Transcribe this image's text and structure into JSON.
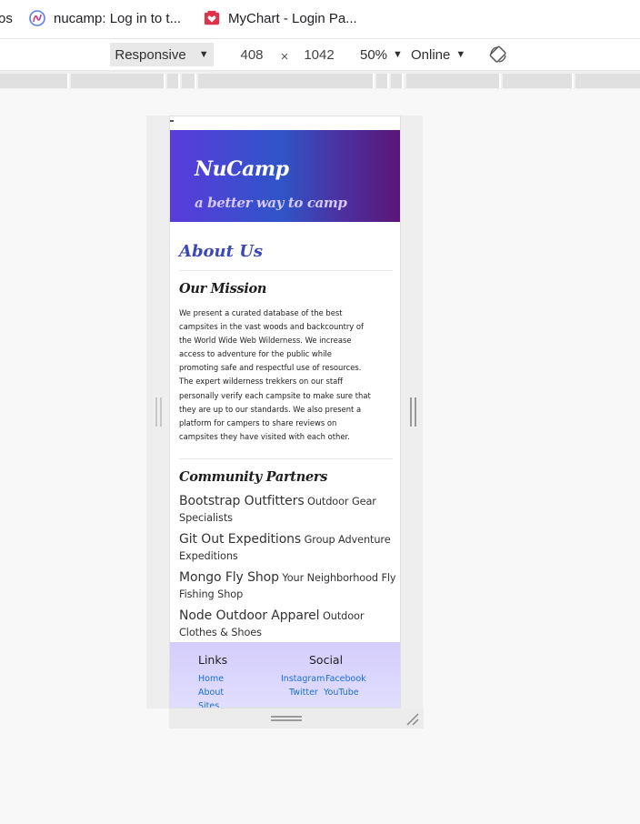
{
  "browser": {
    "bookmarks": [
      {
        "label": "os",
        "icon": "cut-off-icon"
      },
      {
        "label": "nucamp: Log in to t...",
        "icon": "nucamp-logo-icon"
      },
      {
        "label": "MyChart - Login Pa...",
        "icon": "mychart-heart-icon"
      }
    ]
  },
  "devtools": {
    "device_mode": "Responsive",
    "width": "408",
    "times": "×",
    "height": "1042",
    "zoom": "50%",
    "throttling": "Online",
    "rotate_icon": "rotate-icon"
  },
  "site": {
    "brand": "NuCamp",
    "tagline": "a better way to camp",
    "page_title": "About Us",
    "mission": {
      "heading": "Our Mission",
      "lines": [
        "We present a curated database of the best",
        "campsites in the vast woods and backcountry of",
        "the World Wide Web Wilderness. We increase",
        "access to adventure for the public while",
        "promoting safe and respectful use of resources.",
        "The expert wilderness trekkers on our staff",
        "personally verify each campsite to make sure that",
        "they are up to our standards. We also present a",
        "platform for campers to share reviews on",
        "campsites they have visited with each other."
      ]
    },
    "partners": {
      "heading": "Community Partners",
      "items": [
        {
          "name": "Bootstrap Outfitters",
          "desc": "Outdoor Gear Specialists"
        },
        {
          "name": "Git Out Expeditions",
          "desc": "Group Adventure Expeditions"
        },
        {
          "name": "Mongo Fly Shop",
          "desc": "Your Neighborhood Fly Fishing Shop"
        },
        {
          "name": "Node Outdoor Apparel",
          "desc": "Outdoor Clothes & Shoes"
        }
      ]
    },
    "footer": {
      "links_heading": "Links",
      "links": [
        "Home",
        "About",
        "Sites"
      ],
      "social_heading": "Social",
      "social": [
        "Instagram",
        "Facebook",
        "Twitter",
        "YouTube"
      ]
    }
  },
  "colors": {
    "jumbotron_start": "#5a3bdb",
    "jumbotron_end": "#5b1575",
    "title": "#3b48b8",
    "link": "#1a6fe0",
    "footer_bg": "#d4cdfb"
  }
}
